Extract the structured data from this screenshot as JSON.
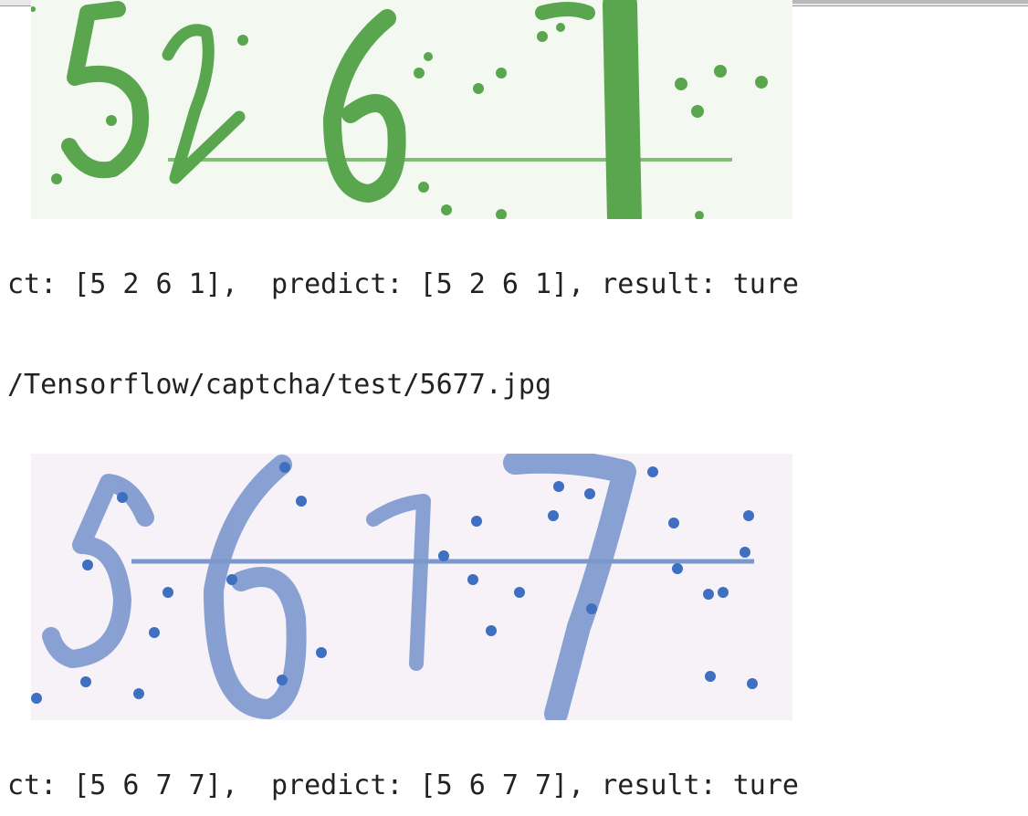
{
  "output": {
    "lines": [
      "ct: [5 2 6 1],  predict: [5 2 6 1], result: ture",
      "/Tensorflow/captcha/test/5677.jpg",
      "ct: [5 6 7 7],  predict: [5 6 7 7], result: ture"
    ]
  },
  "captchas": [
    {
      "digits": "5261",
      "ink_color": "#5aa64f",
      "bg_color": "#f3f8f1"
    },
    {
      "digits": "5677",
      "ink_color": "#6f90c8",
      "bg_color": "#f7f1f8"
    }
  ]
}
